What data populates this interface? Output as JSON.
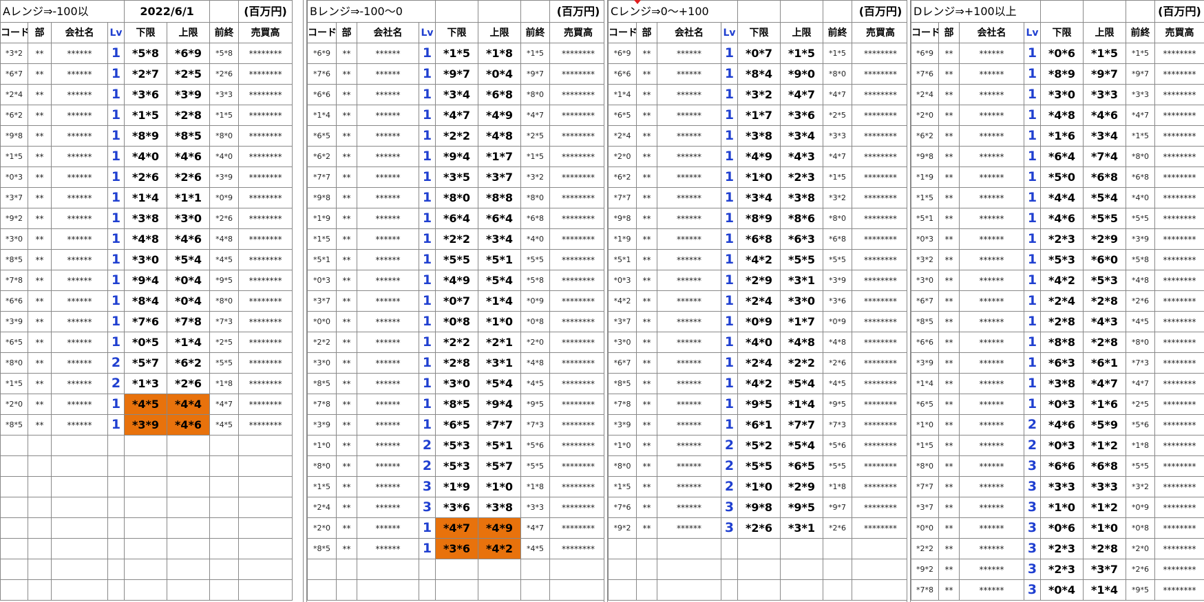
{
  "date": "2022/6/1",
  "unit": "(百万円)",
  "columns": {
    "code": "コード",
    "bu": "部",
    "company": "会社名",
    "lv": "Lv",
    "lower": "下限",
    "upper": "上限",
    "prev": "前終",
    "sales": "売買高"
  },
  "co_mask": "******",
  "sales_mask": "********",
  "bu_mask": "**",
  "highlight_color": "#e8720c",
  "lv_color": "#1f3fd0",
  "sections": [
    {
      "title": "Aレンジ⇒-100以",
      "rows": [
        {
          "code": "*3*2",
          "lv": "1",
          "lower": "*5*8",
          "upper": "*6*9",
          "prev": "*5*8"
        },
        {
          "code": "*6*7",
          "lv": "1",
          "lower": "*2*7",
          "upper": "*2*5",
          "prev": "*2*6"
        },
        {
          "code": "*2*4",
          "lv": "1",
          "lower": "*3*6",
          "upper": "*3*9",
          "prev": "*3*3"
        },
        {
          "code": "*6*2",
          "lv": "1",
          "lower": "*1*5",
          "upper": "*2*8",
          "prev": "*1*5"
        },
        {
          "code": "*9*8",
          "lv": "1",
          "lower": "*8*9",
          "upper": "*8*5",
          "prev": "*8*0"
        },
        {
          "code": "*1*5",
          "lv": "1",
          "lower": "*4*0",
          "upper": "*4*6",
          "prev": "*4*0"
        },
        {
          "code": "*0*3",
          "lv": "1",
          "lower": "*2*6",
          "upper": "*2*6",
          "prev": "*3*9"
        },
        {
          "code": "*3*7",
          "lv": "1",
          "lower": "*1*4",
          "upper": "*1*1",
          "prev": "*0*9"
        },
        {
          "code": "*9*2",
          "lv": "1",
          "lower": "*3*8",
          "upper": "*3*0",
          "prev": "*2*6"
        },
        {
          "code": "*3*0",
          "lv": "1",
          "lower": "*4*8",
          "upper": "*4*6",
          "prev": "*4*8"
        },
        {
          "code": "*8*5",
          "lv": "1",
          "lower": "*3*0",
          "upper": "*5*4",
          "prev": "*4*5"
        },
        {
          "code": "*7*8",
          "lv": "1",
          "lower": "*9*4",
          "upper": "*0*4",
          "prev": "*9*5"
        },
        {
          "code": "*6*6",
          "lv": "1",
          "lower": "*8*4",
          "upper": "*0*4",
          "prev": "*8*0"
        },
        {
          "code": "*3*9",
          "lv": "1",
          "lower": "*7*6",
          "upper": "*7*8",
          "prev": "*7*3"
        },
        {
          "code": "*6*5",
          "lv": "1",
          "lower": "*0*5",
          "upper": "*1*4",
          "prev": "*2*5"
        },
        {
          "code": "*8*0",
          "lv": "2",
          "lower": "*5*7",
          "upper": "*6*2",
          "prev": "*5*5"
        },
        {
          "code": "*1*5",
          "lv": "2",
          "lower": "*1*3",
          "upper": "*2*6",
          "prev": "*1*8"
        },
        {
          "code": "*2*0",
          "lv": "1",
          "lower": "*4*5",
          "upper": "*4*4",
          "prev": "*4*7",
          "hl": true
        },
        {
          "code": "*8*5",
          "lv": "1",
          "lower": "*3*9",
          "upper": "*4*6",
          "prev": "*4*5",
          "hl": true
        }
      ]
    },
    {
      "title": "Bレンジ⇒-100〜0",
      "rows": [
        {
          "code": "*6*9",
          "lv": "1",
          "lower": "*1*5",
          "upper": "*1*8",
          "prev": "*1*5"
        },
        {
          "code": "*7*6",
          "lv": "1",
          "lower": "*9*7",
          "upper": "*0*4",
          "prev": "*9*7"
        },
        {
          "code": "*6*6",
          "lv": "1",
          "lower": "*3*4",
          "upper": "*6*8",
          "prev": "*8*0"
        },
        {
          "code": "*1*4",
          "lv": "1",
          "lower": "*4*7",
          "upper": "*4*9",
          "prev": "*4*7"
        },
        {
          "code": "*6*5",
          "lv": "1",
          "lower": "*2*2",
          "upper": "*4*8",
          "prev": "*2*5"
        },
        {
          "code": "*6*2",
          "lv": "1",
          "lower": "*9*4",
          "upper": "*1*7",
          "prev": "*1*5"
        },
        {
          "code": "*7*7",
          "lv": "1",
          "lower": "*3*5",
          "upper": "*3*7",
          "prev": "*3*2"
        },
        {
          "code": "*9*8",
          "lv": "1",
          "lower": "*8*0",
          "upper": "*8*8",
          "prev": "*8*0"
        },
        {
          "code": "*1*9",
          "lv": "1",
          "lower": "*6*4",
          "upper": "*6*4",
          "prev": "*6*8"
        },
        {
          "code": "*1*5",
          "lv": "1",
          "lower": "*2*2",
          "upper": "*3*4",
          "prev": "*4*0"
        },
        {
          "code": "*5*1",
          "lv": "1",
          "lower": "*5*5",
          "upper": "*5*1",
          "prev": "*5*5"
        },
        {
          "code": "*0*3",
          "lv": "1",
          "lower": "*4*9",
          "upper": "*5*4",
          "prev": "*5*8"
        },
        {
          "code": "*3*7",
          "lv": "1",
          "lower": "*0*7",
          "upper": "*1*4",
          "prev": "*0*9"
        },
        {
          "code": "*0*0",
          "lv": "1",
          "lower": "*0*8",
          "upper": "*1*0",
          "prev": "*0*8"
        },
        {
          "code": "*2*2",
          "lv": "1",
          "lower": "*2*2",
          "upper": "*2*1",
          "prev": "*2*0"
        },
        {
          "code": "*3*0",
          "lv": "1",
          "lower": "*2*8",
          "upper": "*3*1",
          "prev": "*4*8"
        },
        {
          "code": "*8*5",
          "lv": "1",
          "lower": "*3*0",
          "upper": "*5*4",
          "prev": "*4*5"
        },
        {
          "code": "*7*8",
          "lv": "1",
          "lower": "*8*5",
          "upper": "*9*4",
          "prev": "*9*5"
        },
        {
          "code": "*3*9",
          "lv": "1",
          "lower": "*6*5",
          "upper": "*7*7",
          "prev": "*7*3"
        },
        {
          "code": "*1*0",
          "lv": "2",
          "lower": "*5*3",
          "upper": "*5*1",
          "prev": "*5*6"
        },
        {
          "code": "*8*0",
          "lv": "2",
          "lower": "*5*3",
          "upper": "*5*7",
          "prev": "*5*5"
        },
        {
          "code": "*1*5",
          "lv": "3",
          "lower": "*1*9",
          "upper": "*1*0",
          "prev": "*1*8"
        },
        {
          "code": "*2*4",
          "lv": "3",
          "lower": "*3*6",
          "upper": "*3*8",
          "prev": "*3*3"
        },
        {
          "code": "*2*0",
          "lv": "1",
          "lower": "*4*7",
          "upper": "*4*9",
          "prev": "*4*7",
          "hl": true
        },
        {
          "code": "*8*5",
          "lv": "1",
          "lower": "*3*6",
          "upper": "*4*2",
          "prev": "*4*5",
          "hl": true
        }
      ]
    },
    {
      "title": "Cレンジ⇒0〜+100",
      "rows": [
        {
          "code": "*6*9",
          "lv": "1",
          "lower": "*0*7",
          "upper": "*1*5",
          "prev": "*1*5"
        },
        {
          "code": "*6*6",
          "lv": "1",
          "lower": "*8*4",
          "upper": "*9*0",
          "prev": "*8*0"
        },
        {
          "code": "*1*4",
          "lv": "1",
          "lower": "*3*2",
          "upper": "*4*7",
          "prev": "*4*7"
        },
        {
          "code": "*6*5",
          "lv": "1",
          "lower": "*1*7",
          "upper": "*3*6",
          "prev": "*2*5"
        },
        {
          "code": "*2*4",
          "lv": "1",
          "lower": "*3*8",
          "upper": "*3*4",
          "prev": "*3*3"
        },
        {
          "code": "*2*0",
          "lv": "1",
          "lower": "*4*9",
          "upper": "*4*3",
          "prev": "*4*7"
        },
        {
          "code": "*6*2",
          "lv": "1",
          "lower": "*1*0",
          "upper": "*2*3",
          "prev": "*1*5"
        },
        {
          "code": "*7*7",
          "lv": "1",
          "lower": "*3*4",
          "upper": "*3*8",
          "prev": "*3*2"
        },
        {
          "code": "*9*8",
          "lv": "1",
          "lower": "*8*9",
          "upper": "*8*6",
          "prev": "*8*0"
        },
        {
          "code": "*1*9",
          "lv": "1",
          "lower": "*6*8",
          "upper": "*6*3",
          "prev": "*6*8"
        },
        {
          "code": "*5*1",
          "lv": "1",
          "lower": "*4*2",
          "upper": "*5*5",
          "prev": "*5*5"
        },
        {
          "code": "*0*3",
          "lv": "1",
          "lower": "*2*9",
          "upper": "*3*1",
          "prev": "*3*9"
        },
        {
          "code": "*4*2",
          "lv": "1",
          "lower": "*2*4",
          "upper": "*3*0",
          "prev": "*3*6"
        },
        {
          "code": "*3*7",
          "lv": "1",
          "lower": "*0*9",
          "upper": "*1*7",
          "prev": "*0*9"
        },
        {
          "code": "*3*0",
          "lv": "1",
          "lower": "*4*0",
          "upper": "*4*8",
          "prev": "*4*8"
        },
        {
          "code": "*6*7",
          "lv": "1",
          "lower": "*2*4",
          "upper": "*2*2",
          "prev": "*2*6"
        },
        {
          "code": "*8*5",
          "lv": "1",
          "lower": "*4*2",
          "upper": "*5*4",
          "prev": "*4*5"
        },
        {
          "code": "*7*8",
          "lv": "1",
          "lower": "*9*5",
          "upper": "*1*4",
          "prev": "*9*5"
        },
        {
          "code": "*3*9",
          "lv": "1",
          "lower": "*6*1",
          "upper": "*7*7",
          "prev": "*7*3"
        },
        {
          "code": "*1*0",
          "lv": "2",
          "lower": "*5*2",
          "upper": "*5*4",
          "prev": "*5*6"
        },
        {
          "code": "*8*0",
          "lv": "2",
          "lower": "*5*5",
          "upper": "*6*5",
          "prev": "*5*5"
        },
        {
          "code": "*1*5",
          "lv": "2",
          "lower": "*1*0",
          "upper": "*2*9",
          "prev": "*1*8"
        },
        {
          "code": "*7*6",
          "lv": "3",
          "lower": "*9*8",
          "upper": "*9*5",
          "prev": "*9*7"
        },
        {
          "code": "*9*2",
          "lv": "3",
          "lower": "*2*6",
          "upper": "*3*1",
          "prev": "*2*6"
        }
      ]
    },
    {
      "title": "Dレンジ⇒+100以上",
      "rows": [
        {
          "code": "*6*9",
          "lv": "1",
          "lower": "*0*6",
          "upper": "*1*5",
          "prev": "*1*5"
        },
        {
          "code": "*7*6",
          "lv": "1",
          "lower": "*8*9",
          "upper": "*9*7",
          "prev": "*9*7"
        },
        {
          "code": "*2*4",
          "lv": "1",
          "lower": "*3*0",
          "upper": "*3*3",
          "prev": "*3*3"
        },
        {
          "code": "*2*0",
          "lv": "1",
          "lower": "*4*8",
          "upper": "*4*6",
          "prev": "*4*7"
        },
        {
          "code": "*6*2",
          "lv": "1",
          "lower": "*1*6",
          "upper": "*3*4",
          "prev": "*1*5"
        },
        {
          "code": "*9*8",
          "lv": "1",
          "lower": "*6*4",
          "upper": "*7*4",
          "prev": "*8*0"
        },
        {
          "code": "*1*9",
          "lv": "1",
          "lower": "*5*0",
          "upper": "*6*8",
          "prev": "*6*8"
        },
        {
          "code": "*1*5",
          "lv": "1",
          "lower": "*4*4",
          "upper": "*5*4",
          "prev": "*4*0"
        },
        {
          "code": "*5*1",
          "lv": "1",
          "lower": "*4*6",
          "upper": "*5*5",
          "prev": "*5*5"
        },
        {
          "code": "*0*3",
          "lv": "1",
          "lower": "*2*3",
          "upper": "*2*9",
          "prev": "*3*9"
        },
        {
          "code": "*3*2",
          "lv": "1",
          "lower": "*5*3",
          "upper": "*6*0",
          "prev": "*5*8"
        },
        {
          "code": "*3*0",
          "lv": "1",
          "lower": "*4*2",
          "upper": "*5*3",
          "prev": "*4*8"
        },
        {
          "code": "*6*7",
          "lv": "1",
          "lower": "*2*4",
          "upper": "*2*8",
          "prev": "*2*6"
        },
        {
          "code": "*8*5",
          "lv": "1",
          "lower": "*2*8",
          "upper": "*4*3",
          "prev": "*4*5"
        },
        {
          "code": "*6*6",
          "lv": "1",
          "lower": "*8*8",
          "upper": "*2*8",
          "prev": "*8*0"
        },
        {
          "code": "*3*9",
          "lv": "1",
          "lower": "*6*3",
          "upper": "*6*1",
          "prev": "*7*3"
        },
        {
          "code": "*1*4",
          "lv": "1",
          "lower": "*3*8",
          "upper": "*4*7",
          "prev": "*4*7"
        },
        {
          "code": "*6*5",
          "lv": "1",
          "lower": "*0*3",
          "upper": "*1*6",
          "prev": "*2*5"
        },
        {
          "code": "*1*0",
          "lv": "2",
          "lower": "*4*6",
          "upper": "*5*9",
          "prev": "*5*6"
        },
        {
          "code": "*1*5",
          "lv": "2",
          "lower": "*0*3",
          "upper": "*1*2",
          "prev": "*1*8"
        },
        {
          "code": "*8*0",
          "lv": "3",
          "lower": "*6*6",
          "upper": "*6*8",
          "prev": "*5*5"
        },
        {
          "code": "*7*7",
          "lv": "3",
          "lower": "*3*3",
          "upper": "*3*3",
          "prev": "*3*2"
        },
        {
          "code": "*3*7",
          "lv": "3",
          "lower": "*1*0",
          "upper": "*1*2",
          "prev": "*0*9"
        },
        {
          "code": "*0*0",
          "lv": "3",
          "lower": "*0*6",
          "upper": "*1*0",
          "prev": "*0*8"
        },
        {
          "code": "*2*2",
          "lv": "3",
          "lower": "*2*3",
          "upper": "*2*8",
          "prev": "*2*0"
        },
        {
          "code": "*9*2",
          "lv": "3",
          "lower": "*2*3",
          "upper": "*3*7",
          "prev": "*2*6"
        },
        {
          "code": "*7*8",
          "lv": "3",
          "lower": "*0*4",
          "upper": "*1*4",
          "prev": "*9*5"
        }
      ]
    }
  ]
}
